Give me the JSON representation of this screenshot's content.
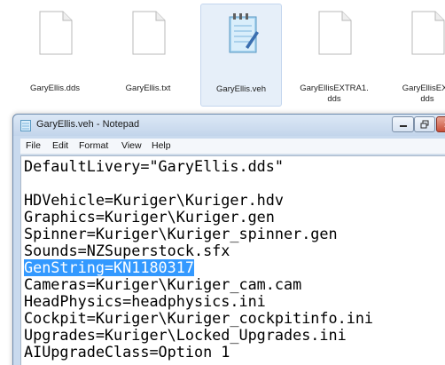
{
  "files": [
    {
      "name": "GaryEllis.dds",
      "icon": "blank-document-icon"
    },
    {
      "name": "GaryEllis.txt",
      "icon": "blank-document-icon"
    },
    {
      "name": "GaryEllis.veh",
      "icon": "notepad-document-icon",
      "selected": true
    },
    {
      "name": "GaryEllisEXTRA1.\ndds",
      "icon": "blank-document-icon"
    },
    {
      "name": "GaryEllisEXT\ndds",
      "icon": "blank-document-icon"
    }
  ],
  "window": {
    "title": "GaryEllis.veh - Notepad",
    "menu": [
      "File",
      "Edit",
      "Format",
      "View",
      "Help"
    ]
  },
  "editor": {
    "lines": [
      "DefaultLivery=\"GaryEllis.dds\"",
      "",
      "HDVehicle=Kuriger\\Kuriger.hdv",
      "Graphics=Kuriger\\Kuriger.gen",
      "Spinner=Kuriger\\Kuriger_spinner.gen",
      "Sounds=NZSuperstock.sfx",
      "GenString=KN1180317",
      "Cameras=Kuriger\\Kuriger_cam.cam",
      "HeadPhysics=headphysics.ini",
      "Cockpit=Kuriger\\Kuriger_cockpitinfo.ini",
      "Upgrades=Kuriger\\Locked_Upgrades.ini",
      "AIUpgradeClass=Option 1"
    ],
    "selected_line": "GenString=KN1180317"
  },
  "colors": {
    "selection": "#3399ff",
    "titlebar": "#c9daee"
  }
}
